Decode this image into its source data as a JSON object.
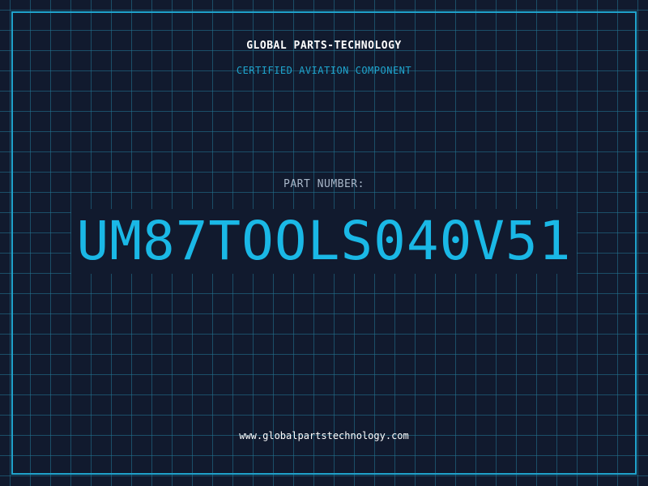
{
  "header": {
    "company": "GLOBAL PARTS-TECHNOLOGY",
    "subtitle": "CERTIFIED AVIATION COMPONENT"
  },
  "main": {
    "part_label": "PART NUMBER:",
    "part_number": "UM87TOOLS040V51"
  },
  "footer": {
    "url": "www.globalpartstechnology.com"
  },
  "colors": {
    "background": "#111a2e",
    "grid": "#237896",
    "accent": "#1fa3cc",
    "part_number": "#1ab8e6"
  }
}
